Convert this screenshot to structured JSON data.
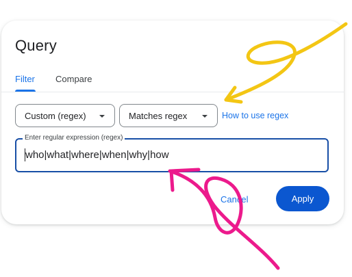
{
  "dialog": {
    "title": "Query",
    "tabs": [
      {
        "label": "Filter",
        "active": true
      },
      {
        "label": "Compare",
        "active": false
      }
    ],
    "match_type_select": {
      "value": "Custom (regex)"
    },
    "operator_select": {
      "value": "Matches regex"
    },
    "help_link": "How to use regex",
    "regex_field": {
      "label": "Enter regular expression (regex)",
      "value": "who|what|where|when|why|how"
    },
    "cancel_label": "Cancel",
    "apply_label": "Apply"
  },
  "colors": {
    "accent": "#1a73e8",
    "apply_button": "#0b57d0",
    "annotation_yellow": "#f3c614",
    "annotation_pink": "#ec1a8c"
  },
  "annotations": [
    {
      "type": "hand-drawn-arrow",
      "color": "yellow",
      "points_to": "help-link"
    },
    {
      "type": "hand-drawn-arrow",
      "color": "pink",
      "points_to": "regex-input"
    }
  ]
}
